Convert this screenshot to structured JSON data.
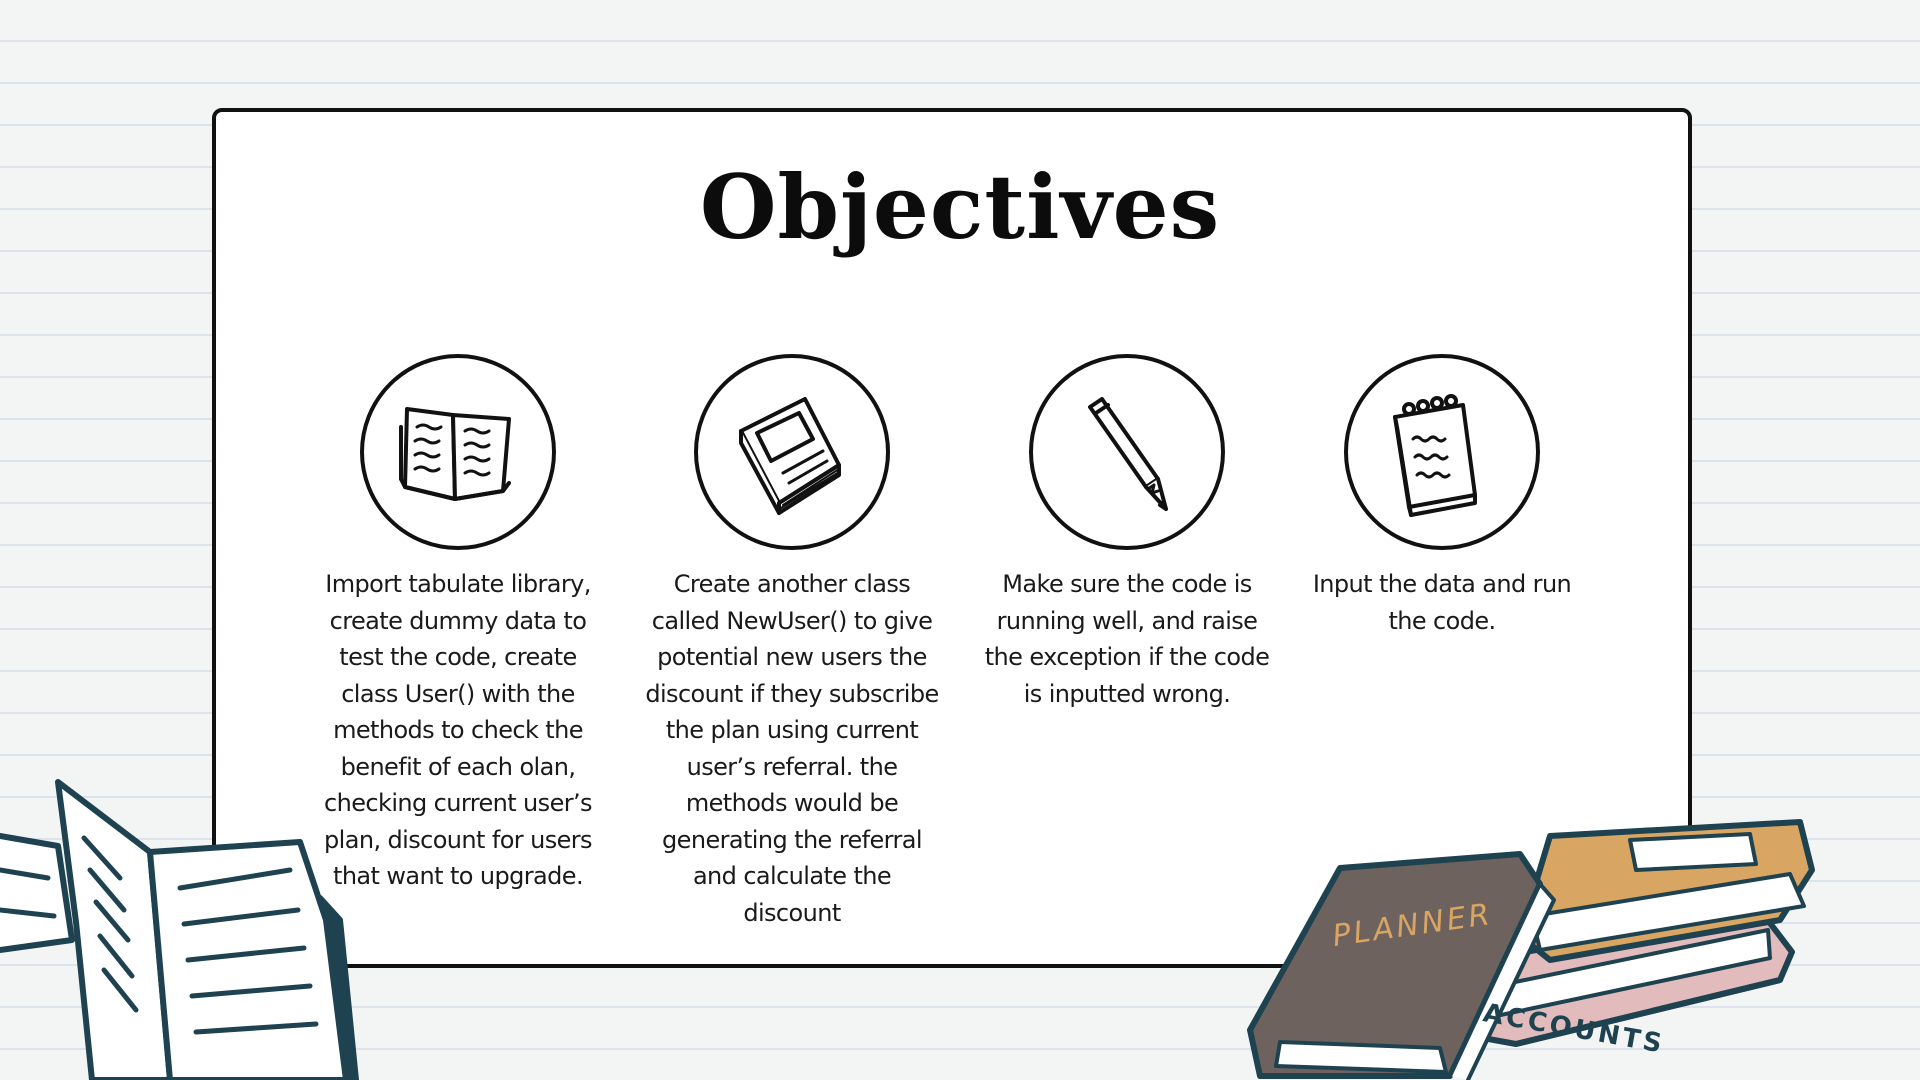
{
  "slide": {
    "title": "Objectives",
    "objectives": [
      {
        "icon": "open-book-icon",
        "text": "Import tabulate library, create dummy data to test the code, create class User() with the methods to check the benefit of each olan, checking current user’s plan, discount for users that want to upgrade."
      },
      {
        "icon": "closed-book-icon",
        "text": "Create another class called NewUser() to give potential new users the discount if they subscribe the plan using current user’s referral. the methods would be generating the referral and calculate the discount"
      },
      {
        "icon": "pencil-icon",
        "text": "Make sure the code is running well, and raise the exception if the code is inputted wrong."
      },
      {
        "icon": "notepad-icon",
        "text": "Input the data and run the code."
      }
    ]
  },
  "decorations": {
    "planner_label": "PLANNER",
    "accounts_label": "ACCOUNTS"
  },
  "colors": {
    "background": "#f3f4f4",
    "ruled_line": "#dde3ec",
    "ink": "#111111",
    "book_outline": "#1e4250",
    "planner_brown": "#6e625f",
    "notebook_tan": "#d9a562",
    "accounts_pink": "#e2bcbc"
  }
}
